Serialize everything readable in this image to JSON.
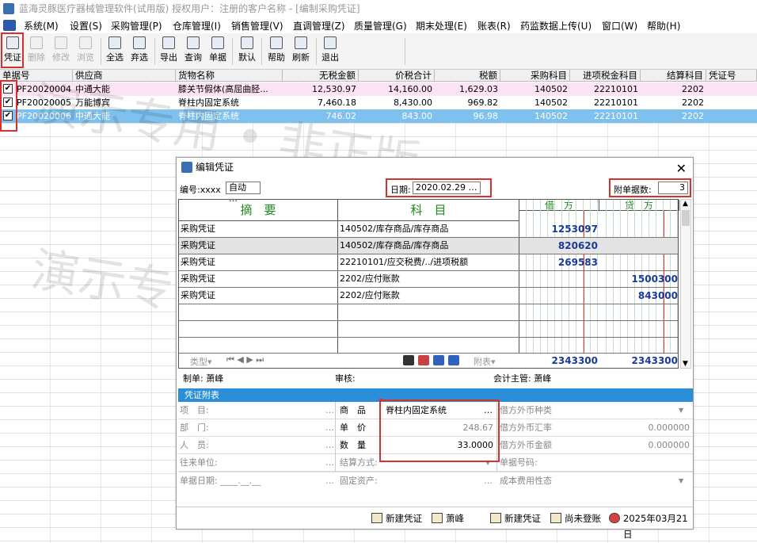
{
  "window_title": "蓝海灵豚医疗器械管理软件(试用版)    授权用户：注册的客户名称 - [编制采购凭证]",
  "menu": [
    "系统(M)",
    "设置(S)",
    "采购管理(P)",
    "仓库管理(I)",
    "销售管理(V)",
    "直调管理(Z)",
    "质量管理(G)",
    "期末处理(E)",
    "账表(R)",
    "药监数据上传(U)",
    "窗口(W)",
    "帮助(H)"
  ],
  "toolbar": {
    "voucher": "凭证",
    "delete": "删除",
    "modify": "修改",
    "browse": "浏览",
    "select_all": "全选",
    "discard_select": "弃选",
    "export": "导出",
    "query": "查询",
    "document": "单据",
    "default": "默认",
    "help": "帮助",
    "refresh": "刷新",
    "exit": "退出"
  },
  "grid": {
    "headers": [
      "单据号",
      "供应商",
      "货物名称",
      "无税金额",
      "价税合计",
      "税额",
      "采购科目",
      "进项税金科目",
      "结算科目",
      "凭证号"
    ],
    "rows": [
      {
        "id": "PF20020004",
        "supplier": "中通大能",
        "goods": "膝关节假体(高屈曲胫...",
        "notax": "12,530.97",
        "total": "14,160.00",
        "tax": "1,629.03",
        "purchase": "140502",
        "inputtax": "22210101",
        "settle": "2202",
        "voucher": ""
      },
      {
        "id": "PF20020005",
        "supplier": "万能博宾",
        "goods": "脊柱内固定系统",
        "notax": "7,460.18",
        "total": "8,430.00",
        "tax": "969.82",
        "purchase": "140502",
        "inputtax": "22210101",
        "settle": "2202",
        "voucher": ""
      },
      {
        "id": "PF20020006",
        "supplier": "中通大能",
        "goods": "脊柱内固定系统",
        "notax": "746.02",
        "total": "843.00",
        "tax": "96.98",
        "purchase": "140502",
        "inputtax": "22210101",
        "settle": "2202",
        "voucher": ""
      }
    ]
  },
  "watermark": {
    "line1": "演示专用 • 非正版",
    "line2": "演示专"
  },
  "dialog": {
    "title": "编辑凭证",
    "number_label": "编号:",
    "number_value": "xxxx",
    "auto_label": "自动",
    "date_label": "日期:",
    "date_value": "2020.02.29",
    "attach_label": "附单据数:",
    "attach_value": "3",
    "col_summary": "摘　要",
    "col_subject": "科　目",
    "col_debit": "借　方",
    "col_credit": "贷　方",
    "entries": [
      {
        "summary": "采购凭证",
        "subject": "140502/库存商品/库存商品",
        "debit": "1253097",
        "credit": ""
      },
      {
        "summary": "采购凭证",
        "subject": "140502/库存商品/库存商品",
        "debit": "820620",
        "credit": ""
      },
      {
        "summary": "采购凭证",
        "subject": "22210101/应交税费/../进项税额",
        "debit": "269583",
        "credit": ""
      },
      {
        "summary": "采购凭证",
        "subject": "2202/应付账款",
        "debit": "",
        "credit": "1500300"
      },
      {
        "summary": "采购凭证",
        "subject": "2202/应付账款",
        "debit": "",
        "credit": "843000"
      }
    ],
    "total_debit": "2343300",
    "total_credit": "2343300",
    "vtoolbar_type": "类型▾",
    "vtoolbar_attach": "附表▾",
    "maker_label": "制单:",
    "maker": "萧峰",
    "auditor_label": "审核:",
    "accountant_label": "会计主管:",
    "accountant": "萧峰",
    "attach_title": "凭证附表",
    "attach": {
      "project": "项　目:",
      "dept": "部　门:",
      "staff": "人　员:",
      "contact": "往来单位:",
      "doc_date": "单据日期:",
      "doc_date_value": "____.__.__",
      "goods_label": "商　品",
      "goods_value": "脊柱内固定系统",
      "price_label": "单　价",
      "price_value": "248.67",
      "qty_label": "数　量",
      "qty_value": "33.0000",
      "settle_method": "结算方式:",
      "fixed_asset": "固定资产:",
      "fx_type": "借方外币种类",
      "fx_rate": "借方外币汇率",
      "fx_rate_value": "0.000000",
      "fx_amount": "借方外币金额",
      "fx_amount_value": "0.000000",
      "doc_no": "单据号码:",
      "cost_nature": "成本费用性态"
    }
  },
  "status": {
    "new1": "新建凭证",
    "user": "萧峰",
    "new2": "新建凭证",
    "unposted": "尚未登账",
    "date": "2025年03月21日"
  }
}
